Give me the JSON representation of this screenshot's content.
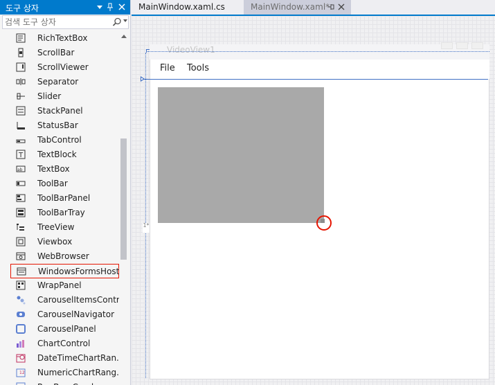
{
  "toolbox": {
    "title": "도구 상자",
    "search_placeholder": "검색 도구 상자",
    "header_icons": [
      "dropdown-arrow-icon",
      "pin-icon",
      "close-icon"
    ],
    "items": [
      {
        "label": "RichTextBox",
        "icon": "richtextbox-icon"
      },
      {
        "label": "ScrollBar",
        "icon": "scrollbar-icon"
      },
      {
        "label": "ScrollViewer",
        "icon": "scrollviewer-icon"
      },
      {
        "label": "Separator",
        "icon": "separator-icon"
      },
      {
        "label": "Slider",
        "icon": "slider-icon"
      },
      {
        "label": "StackPanel",
        "icon": "stackpanel-icon"
      },
      {
        "label": "StatusBar",
        "icon": "statusbar-icon"
      },
      {
        "label": "TabControl",
        "icon": "tabcontrol-icon"
      },
      {
        "label": "TextBlock",
        "icon": "textblock-icon"
      },
      {
        "label": "TextBox",
        "icon": "textbox-icon"
      },
      {
        "label": "ToolBar",
        "icon": "toolbar-icon"
      },
      {
        "label": "ToolBarPanel",
        "icon": "toolbarpanel-icon"
      },
      {
        "label": "ToolBarTray",
        "icon": "toolbartray-icon"
      },
      {
        "label": "TreeView",
        "icon": "treeview-icon"
      },
      {
        "label": "Viewbox",
        "icon": "viewbox-icon"
      },
      {
        "label": "WebBrowser",
        "icon": "webbrowser-icon"
      },
      {
        "label": "WindowsFormsHost",
        "icon": "windowsformshost-icon",
        "selected": true
      },
      {
        "label": "WrapPanel",
        "icon": "wrappanel-icon"
      },
      {
        "label": "CarouselItemsContr...",
        "icon": "carousel-items-icon"
      },
      {
        "label": "CarouselNavigator",
        "icon": "carousel-navigator-icon"
      },
      {
        "label": "CarouselPanel",
        "icon": "carousel-panel-icon"
      },
      {
        "label": "ChartControl",
        "icon": "chart-control-icon"
      },
      {
        "label": "DateTimeChartRan...",
        "icon": "datetime-chart-icon"
      },
      {
        "label": "NumericChartRang...",
        "icon": "numeric-chart-icon"
      },
      {
        "label": "R....B..., C.....l",
        "icon": "generic-control-icon"
      }
    ]
  },
  "tabs": [
    {
      "label": "MainWindow.xaml.cs",
      "active": true
    },
    {
      "label": "MainWindow.xaml*",
      "active": false,
      "pin_icon": "pin-icon",
      "close_icon": "close-icon"
    }
  ],
  "designer": {
    "window_title": "VideoView1",
    "menu": [
      "File",
      "Tools"
    ],
    "grid_marker": "1*"
  },
  "colors": {
    "accent": "#007acc",
    "selection_red": "#e51400",
    "host_fill": "#a9a9a9",
    "guide_blue": "#3f6fc4"
  }
}
